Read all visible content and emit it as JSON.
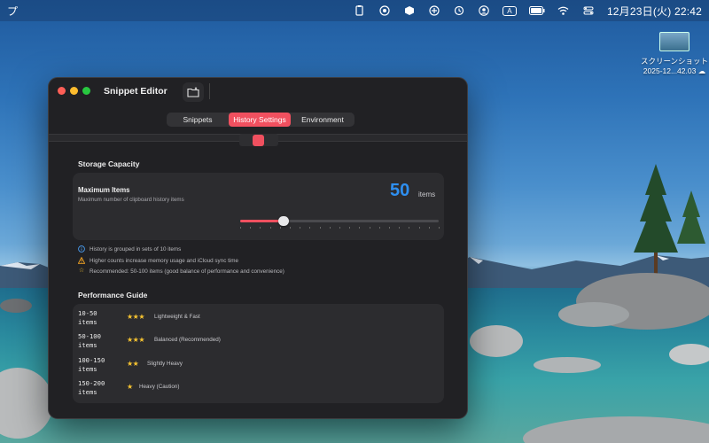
{
  "menubar": {
    "app_glyph": "プ",
    "clock": "12月23日(火) 22:42",
    "icons": [
      "clipboard-icon",
      "focus-icon",
      "cube-icon",
      "blocks-icon",
      "time-machine-icon",
      "user-icon",
      "input-source-icon",
      "battery-icon",
      "wifi-icon",
      "control-center-icon"
    ],
    "input_source_label": "A"
  },
  "desktop_file": {
    "name_line1": "スクリーンショット",
    "name_line2": "2025-12...42.03"
  },
  "window": {
    "title": "Snippet Editor",
    "tabs": [
      {
        "label": "Snippets"
      },
      {
        "label": "History Settings"
      },
      {
        "label": "Environment"
      }
    ],
    "storage": {
      "section_title": "Storage Capacity",
      "card_title": "Maximum Items",
      "card_subtitle": "Maximum number of clipboard history items",
      "value": "50",
      "unit": "items",
      "slider_fraction": 0.22
    },
    "notes": [
      {
        "icon": "info-icon",
        "text": "History is grouped in sets of 10 items"
      },
      {
        "icon": "warning-icon",
        "text": "Higher counts increase memory usage and iCloud sync time"
      },
      {
        "icon": "star-icon",
        "text": "Recommended: 50-100 items (good balance of performance and convenience)"
      }
    ],
    "guide": {
      "section_title": "Performance Guide",
      "rows": [
        {
          "range_line1": "10-50",
          "range_line2": "items",
          "stars": "★★★",
          "desc": "Lightweight & Fast"
        },
        {
          "range_line1": "50-100",
          "range_line2": "items",
          "stars": "★★★",
          "desc": "Balanced (Recommended)"
        },
        {
          "range_line1": "100-150",
          "range_line2": "items",
          "stars": "★★",
          "desc": "Slightly Heavy"
        },
        {
          "range_line1": "150-200",
          "range_line2": "items",
          "stars": "★",
          "desc": "Heavy (Caution)"
        }
      ]
    }
  },
  "colors": {
    "accent": "#f0505f",
    "value_blue": "#2e8ff0",
    "star": "#f7c431",
    "window_bg": "#212124",
    "card_bg": "#2c2c2f"
  }
}
